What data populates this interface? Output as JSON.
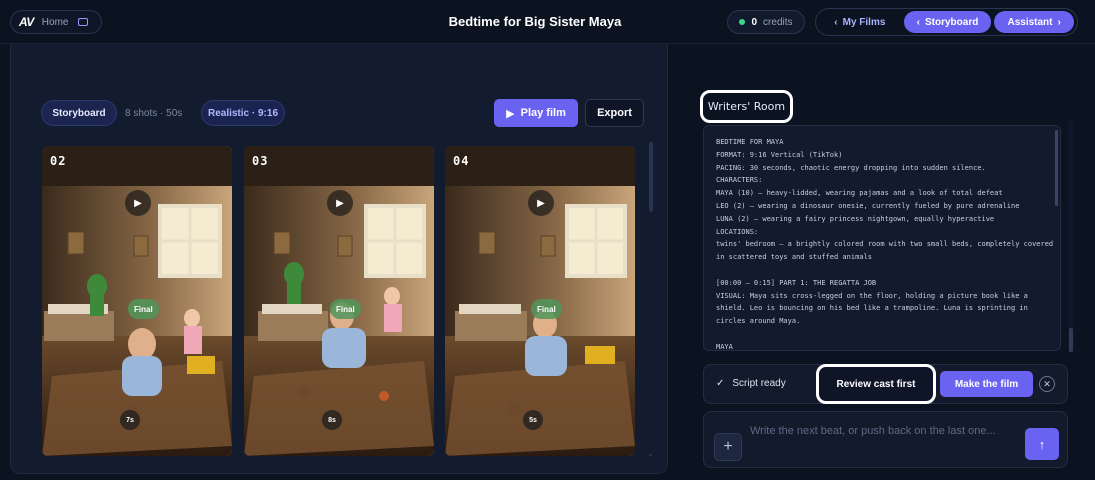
{
  "header": {
    "brand": "AV",
    "home_label": "Home",
    "title": "Bedtime for Big Sister Maya",
    "credits_value": "0",
    "credits_label": "credits",
    "nav": {
      "my_films": "My Films",
      "storyboard": "Storyboard",
      "assistant": "Assistant"
    }
  },
  "storyboard": {
    "tab_label": "Storyboard",
    "shots_info": "8 shots · 50s",
    "style_label": "Realistic · 9:16",
    "play_label": "Play film",
    "export_label": "Export",
    "cards": [
      {
        "number": "02",
        "badge": "Final",
        "duration": "7s"
      },
      {
        "number": "03",
        "badge": "Final",
        "duration": "8s"
      },
      {
        "number": "04",
        "badge": "Final",
        "duration": "5s"
      }
    ]
  },
  "writers_room": {
    "title": "Writers' Room",
    "script_lines": [
      "BEDTIME FOR MAYA",
      "FORMAT: 9:16 Vertical (TikTok)",
      "PACING: 30 seconds, chaotic energy dropping into sudden silence.",
      "CHARACTERS:",
      "MAYA (10) — heavy-lidded, wearing pajamas and a look of total defeat",
      "LEO (2) — wearing a dinosaur onesie, currently fueled by pure adrenaline",
      "LUNA (2) — wearing a fairy princess nightgown, equally hyperactive",
      "LOCATIONS:",
      "twins' bedroom — a brightly colored room with two small beds, completely covered",
      "in scattered toys and stuffed animals",
      "",
      "[00:00 – 0:15] PART 1: THE REGATTA JOB",
      "VISUAL: Maya sits cross-legged on the floor, holding a picture book like a",
      "shield. Leo is bouncing on his bed like a trampoline. Luna is sprinting in",
      "circles around Maya.",
      "",
      "MAYA"
    ],
    "status_label": "Script ready",
    "review_label": "Review cast first",
    "make_label": "Make the film",
    "composer_placeholder": "Write the next beat, or push back on the last one..."
  },
  "icons": {
    "check": "check-icon",
    "play": "play-icon",
    "close": "close-icon",
    "add": "plus-icon",
    "send": "arrow-up-icon"
  },
  "colors": {
    "accent": "#6a62f0",
    "background": "#0b1220",
    "panel": "#131b2e",
    "status_dot": "#39d98a",
    "badge_final": "#5a9a62"
  }
}
